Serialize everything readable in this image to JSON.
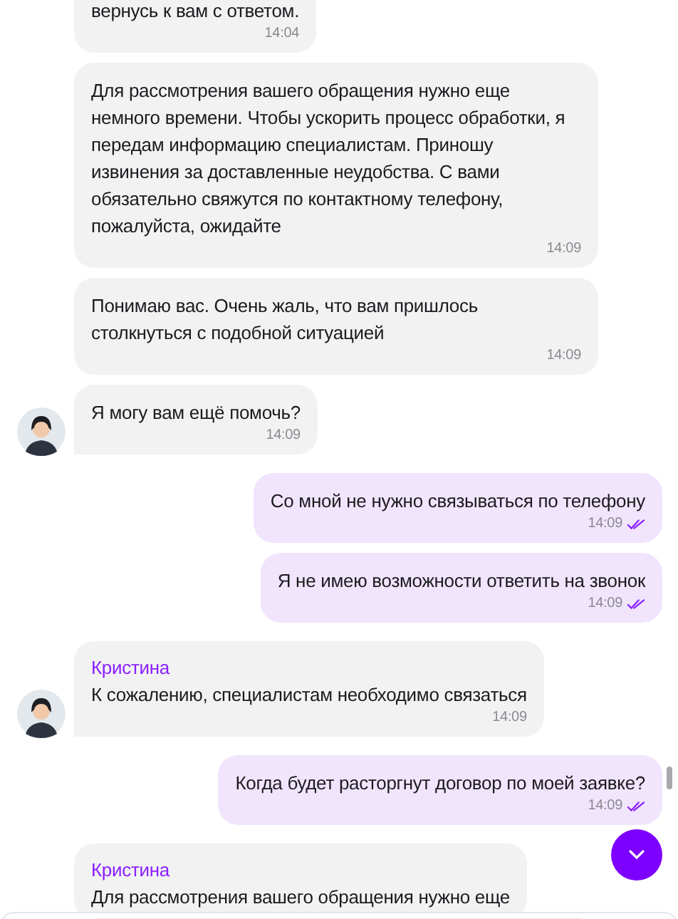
{
  "messages": [
    {
      "kind": "agent",
      "text": "вернусь к вам с ответом.",
      "time": "14:04",
      "avatar": false
    },
    {
      "kind": "agent",
      "text": "Для рассмотрения вашего обращения нужно еще немного времени. Чтобы ускорить процесс обработки, я передам информацию специалистам. Приношу извинения за доставленные неудобства. С вами обязательно свяжутся по контактному телефону, пожалуйста, ожидайте",
      "time": "14:09",
      "avatar": false
    },
    {
      "kind": "agent",
      "text": "Понимаю вас. Очень жаль, что вам пришлось столкнуться с подобной ситуацией",
      "time": "14:09",
      "avatar": false
    },
    {
      "kind": "agent",
      "text": "Я могу вам ещё помочь?",
      "time": "14:09",
      "avatar": true
    },
    {
      "kind": "user",
      "text": "Со мной не нужно связываться по телефону",
      "time": "14:09",
      "read": true
    },
    {
      "kind": "user",
      "text": "Я не имею возможности ответить на звонок",
      "time": "14:09",
      "read": true
    },
    {
      "kind": "agent",
      "name": "Кристина",
      "text": "К сожалению, специалистам необходимо связаться",
      "time": "14:09",
      "avatar": true
    },
    {
      "kind": "user",
      "text": "Когда будет расторгнут договор по моей заявке?",
      "time": "14:09",
      "read": true
    },
    {
      "kind": "agent",
      "name": "Кристина",
      "text": "Для рассмотрения вашего обращения нужно еще",
      "avatar": false
    }
  ]
}
